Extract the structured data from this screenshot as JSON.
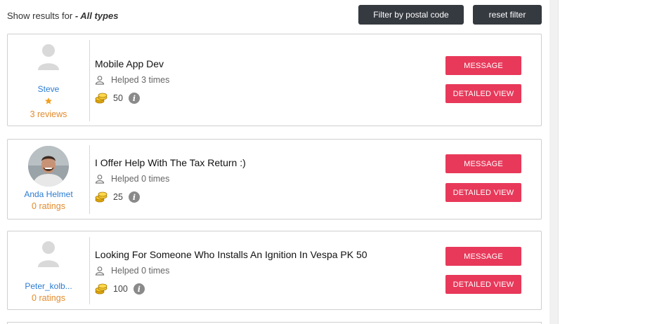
{
  "filter": {
    "results_prefix": "Show results for",
    "results_type": "- All types",
    "postal_button": "Filter by postal code",
    "reset_button": "reset filter"
  },
  "listings": [
    {
      "user": "Steve",
      "avatar": "placeholder",
      "star_icon": "star-icon",
      "rating_text": "3 reviews",
      "title": "Mobile App Dev",
      "helped": "Helped 3 times",
      "coins": "50",
      "message_button": "MESSAGE",
      "detail_button": "DETAILED VIEW"
    },
    {
      "user": "Anda Helmet",
      "avatar": "photo",
      "rating_text": "0 ratings",
      "title": "I Offer Help With The Tax Return :)",
      "helped": "Helped 0 times",
      "coins": "25",
      "message_button": "MESSAGE",
      "detail_button": "DETAILED VIEW"
    },
    {
      "user": "Peter_kolb...",
      "avatar": "placeholder",
      "rating_text": "0 ratings",
      "title": "Looking For Someone Who Installs An Ignition In Vespa PK 50",
      "helped": "Helped 0 times",
      "coins": "100",
      "message_button": "MESSAGE",
      "detail_button": "DETAILED VIEW"
    }
  ],
  "colors": {
    "accent_red": "#e8395a",
    "dark_button": "#353a40",
    "link_blue": "#2b7cd3",
    "rating_orange": "#e38b2c"
  }
}
